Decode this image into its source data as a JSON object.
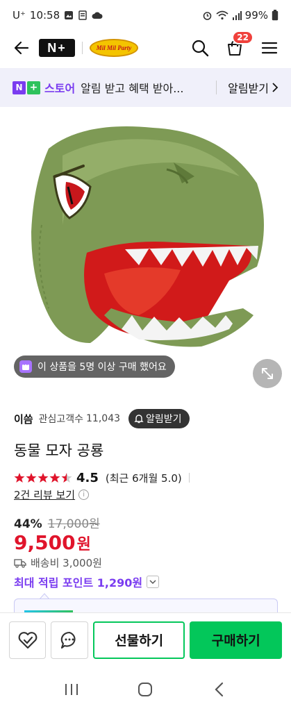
{
  "status_bar": {
    "carrier": "U⁺",
    "time": "10:58",
    "battery": "99%"
  },
  "header": {
    "back_icon": "arrow-left-icon",
    "nplus_logo": "N+",
    "brand_logo_text": "Mil Mil Party",
    "search_icon": "search-icon",
    "cart_icon": "cart-icon",
    "cart_count": "22",
    "menu_icon": "hamburger-icon"
  },
  "store_banner": {
    "store_name": "스토어",
    "message": "알림 받고 혜택 받아...",
    "button_label": "알림받기"
  },
  "product": {
    "buyer_notice": "이 상품을 5명 이상 구매 했어요",
    "seller_name": "이씀",
    "interest_label": "관심고객수",
    "interest_count": "11,043",
    "notify_label": "알림받기",
    "title": "동물 모자 공룡",
    "rating": "4.5",
    "rating_stars": 4.5,
    "rating_recent": "(최근 6개월 5.0)",
    "review_link": "2건 리뷰 보기",
    "discount_pct": "44%",
    "original_price": "17,000원",
    "price": "9,500",
    "price_unit": "원",
    "shipping": "배송비 3,000원",
    "max_points": "최대 적립 포인트 1,290원"
  },
  "colors": {
    "accent_green": "#03c75a",
    "price_red": "#e0142b",
    "store_purple": "#7a3cf0",
    "star_red": "#e0142b"
  },
  "actions": {
    "wishlist_icon": "heart-check-icon",
    "talk_icon": "chat-bubble-icon",
    "gift_label": "선물하기",
    "buy_label": "구매하기"
  },
  "nav": {
    "recents_icon": "recents-icon",
    "home_icon": "home-icon",
    "back_icon": "back-chevron-icon"
  }
}
